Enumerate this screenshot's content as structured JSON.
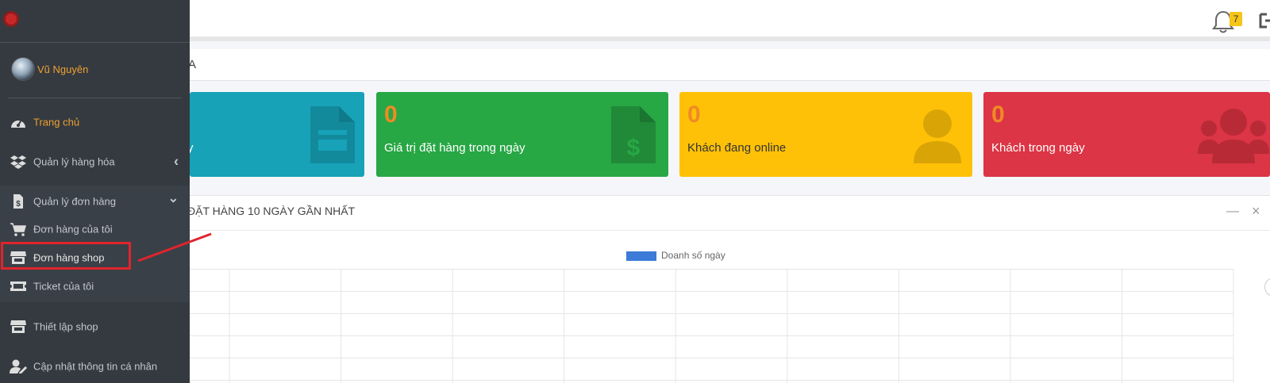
{
  "header": {
    "notification_count": "7"
  },
  "sidebar": {
    "user_name": "Vũ Nguyên",
    "items": [
      {
        "label": "Trang chủ",
        "icon": "dashboard-icon",
        "active": true
      },
      {
        "label": "Quản lý hàng hóa",
        "icon": "dropbox-icon",
        "arrow": "‹"
      },
      {
        "label": "Quản lý đơn hàng",
        "icon": "invoice-icon",
        "arrow": "⌄"
      },
      {
        "label": "Đơn hàng của tôi",
        "icon": "cart-icon"
      },
      {
        "label": "Đơn hàng shop",
        "icon": "store-icon",
        "highlighted": true
      },
      {
        "label": "Ticket của tôi",
        "icon": "ticket-icon"
      },
      {
        "label": "Thiết lập shop",
        "icon": "store-icon"
      },
      {
        "label": "Cập nhật thông tin cá nhân",
        "icon": "user-edit-icon"
      }
    ]
  },
  "content": {
    "title_fragment": "A"
  },
  "cards": [
    {
      "value": "",
      "label": "y",
      "color": "#17a2b8",
      "icon": "document-icon"
    },
    {
      "value": "0",
      "label": "Giá trị đặt hàng trong ngày",
      "color": "#28a745",
      "icon": "invoice-dollar-icon"
    },
    {
      "value": "0",
      "label": "Khách đang online",
      "color": "#ffc107",
      "icon": "user-icon"
    },
    {
      "value": "0",
      "label": "Khách trong ngày",
      "color": "#dc3545",
      "icon": "users-icon"
    }
  ],
  "chart_panel": {
    "title": "ĐẶT HÀNG 10 NGÀY GẦN NHẤT",
    "minimize": "—",
    "close": "×"
  },
  "chart_data": {
    "type": "bar",
    "title": "",
    "series": [
      {
        "name": "Doanh số ngày",
        "values": []
      }
    ],
    "categories": [],
    "grid": true,
    "legend": "top-center",
    "colors": {
      "Doanh số ngày": "#3c7bd8"
    }
  }
}
